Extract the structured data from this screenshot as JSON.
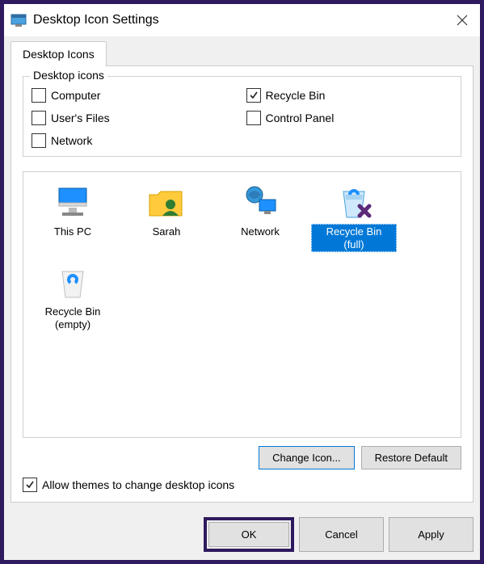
{
  "window": {
    "title": "Desktop Icon Settings"
  },
  "tabs": {
    "desktop_icons": "Desktop Icons"
  },
  "group": {
    "label": "Desktop icons",
    "items": {
      "computer": {
        "label": "Computer",
        "checked": false
      },
      "recycle_bin": {
        "label": "Recycle Bin",
        "checked": true
      },
      "users_files": {
        "label": "User's Files",
        "checked": false
      },
      "control_panel": {
        "label": "Control Panel",
        "checked": false
      },
      "network": {
        "label": "Network",
        "checked": false
      }
    }
  },
  "preview": {
    "items": [
      {
        "id": "this_pc",
        "label": "This PC",
        "icon": "monitor-icon",
        "selected": false
      },
      {
        "id": "sarah",
        "label": "Sarah",
        "icon": "user-folder-icon",
        "selected": false
      },
      {
        "id": "network",
        "label": "Network",
        "icon": "network-icon",
        "selected": false
      },
      {
        "id": "recycle_full",
        "label": "Recycle Bin (full)",
        "icon": "recycle-full-icon",
        "selected": true
      },
      {
        "id": "recycle_empty",
        "label": "Recycle Bin (empty)",
        "icon": "recycle-empty-icon",
        "selected": false
      }
    ]
  },
  "buttons": {
    "change_icon": "Change Icon...",
    "restore_default": "Restore Default",
    "ok": "OK",
    "cancel": "Cancel",
    "apply": "Apply"
  },
  "themes": {
    "label": "Allow themes to change desktop icons",
    "checked": true
  }
}
